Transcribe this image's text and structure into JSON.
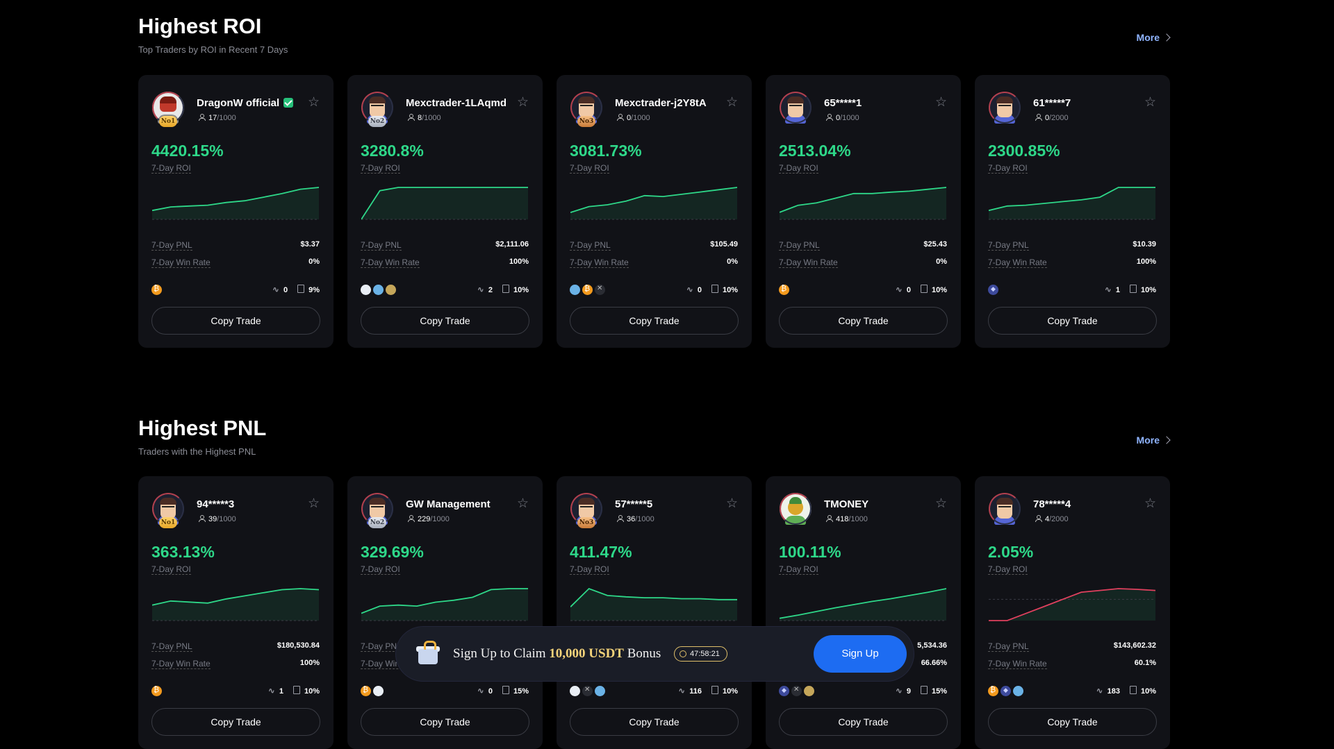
{
  "sections": [
    {
      "title": "Highest ROI",
      "subtitle": "Top Traders by ROI in Recent 7 Days",
      "more": "More",
      "cards": [
        {
          "name": "DragonW official",
          "verified": true,
          "rank": "No1",
          "followers": "17",
          "max": "/1000",
          "roi": "4420.15%",
          "roi_label": "7-Day ROI",
          "pnl_label": "7-Day PNL",
          "pnl": "$3.37",
          "wr_label": "7-Day Win Rate",
          "wr": "0%",
          "coins": [
            "btc"
          ],
          "trades": "0",
          "share": "9%",
          "copy": "Copy Trade",
          "avatar": "robot",
          "spark": [
            0.2,
            0.28,
            0.3,
            0.32,
            0.38,
            0.42,
            0.5,
            0.58,
            0.68,
            0.72
          ]
        },
        {
          "name": "Mexctrader-1LAqmd",
          "verified": false,
          "rank": "No2",
          "followers": "8",
          "max": "/1000",
          "roi": "3280.8%",
          "roi_label": "7-Day ROI",
          "pnl_label": "7-Day PNL",
          "pnl": "$2,111.06",
          "wr_label": "7-Day Win Rate",
          "wr": "100%",
          "coins": [
            "wht",
            "usd",
            "dog"
          ],
          "trades": "2",
          "share": "10%",
          "copy": "Copy Trade",
          "avatar": "person",
          "spark": [
            0.0,
            0.7,
            0.78,
            0.78,
            0.78,
            0.78,
            0.78,
            0.78,
            0.78,
            0.78
          ]
        },
        {
          "name": "Mexctrader-j2Y8tA",
          "verified": false,
          "rank": "No3",
          "followers": "0",
          "max": "/1000",
          "roi": "3081.73%",
          "roi_label": "7-Day ROI",
          "pnl_label": "7-Day PNL",
          "pnl": "$105.49",
          "wr_label": "7-Day Win Rate",
          "wr": "0%",
          "coins": [
            "usd",
            "btc",
            "x"
          ],
          "trades": "0",
          "share": "10%",
          "copy": "Copy Trade",
          "avatar": "person",
          "spark": [
            0.15,
            0.28,
            0.32,
            0.4,
            0.52,
            0.5,
            0.55,
            0.6,
            0.65,
            0.7
          ]
        },
        {
          "name": "65*****1",
          "verified": false,
          "rank": "",
          "followers": "0",
          "max": "/1000",
          "roi": "2513.04%",
          "roi_label": "7-Day ROI",
          "pnl_label": "7-Day PNL",
          "pnl": "$25.43",
          "wr_label": "7-Day Win Rate",
          "wr": "0%",
          "coins": [
            "btc"
          ],
          "trades": "0",
          "share": "10%",
          "copy": "Copy Trade",
          "avatar": "person",
          "spark": [
            0.15,
            0.3,
            0.35,
            0.45,
            0.55,
            0.55,
            0.58,
            0.6,
            0.64,
            0.68
          ]
        },
        {
          "name": "61*****7",
          "verified": false,
          "rank": "",
          "followers": "0",
          "max": "/2000",
          "roi": "2300.85%",
          "roi_label": "7-Day ROI",
          "pnl_label": "7-Day PNL",
          "pnl": "$10.39",
          "wr_label": "7-Day Win Rate",
          "wr": "100%",
          "coins": [
            "eth"
          ],
          "trades": "1",
          "share": "10%",
          "copy": "Copy Trade",
          "avatar": "person",
          "spark": [
            0.2,
            0.3,
            0.32,
            0.36,
            0.4,
            0.44,
            0.5,
            0.72,
            0.72,
            0.72
          ]
        }
      ]
    },
    {
      "title": "Highest PNL",
      "subtitle": "Traders with the Highest PNL",
      "more": "More",
      "cards": [
        {
          "name": "94*****3",
          "verified": false,
          "rank": "No1",
          "followers": "39",
          "max": "/1000",
          "roi": "363.13%",
          "roi_label": "7-Day ROI",
          "pnl_label": "7-Day PNL",
          "pnl": "$180,530.84",
          "wr_label": "7-Day Win Rate",
          "wr": "100%",
          "coins": [
            "btc"
          ],
          "trades": "1",
          "share": "10%",
          "copy": "Copy Trade",
          "avatar": "person",
          "spark": [
            0.3,
            0.38,
            0.36,
            0.34,
            0.42,
            0.48,
            0.54,
            0.6,
            0.62,
            0.6
          ]
        },
        {
          "name": "GW Management",
          "verified": false,
          "rank": "No2",
          "followers": "229",
          "max": "/1000",
          "roi": "329.69%",
          "roi_label": "7-Day ROI",
          "pnl_label": "7-Day PNL",
          "pnl": "",
          "wr_label": "7-Day Win Rate",
          "wr": "",
          "coins": [
            "btc",
            "wht"
          ],
          "trades": "0",
          "share": "15%",
          "copy": "Copy Trade",
          "avatar": "person",
          "spark": [
            0.15,
            0.3,
            0.32,
            0.3,
            0.38,
            0.42,
            0.48,
            0.64,
            0.66,
            0.66
          ]
        },
        {
          "name": "57*****5",
          "verified": false,
          "rank": "No3",
          "followers": "36",
          "max": "/1000",
          "roi": "411.47%",
          "roi_label": "7-Day ROI",
          "pnl_label": "7-Day PNL",
          "pnl": "",
          "wr_label": "7-Day Win Rate",
          "wr": "",
          "coins": [
            "wht",
            "x",
            "usd"
          ],
          "trades": "116",
          "share": "10%",
          "copy": "Copy Trade",
          "avatar": "person",
          "spark": [
            0.3,
            0.7,
            0.55,
            0.52,
            0.5,
            0.5,
            0.48,
            0.48,
            0.46,
            0.46
          ]
        },
        {
          "name": "TMONEY",
          "verified": false,
          "rank": "",
          "followers": "418",
          "max": "/1000",
          "roi": "100.11%",
          "roi_label": "7-Day ROI",
          "pnl_label": "7-Day PNL",
          "pnl": "5,534.36",
          "wr_label": "7-Day Win Rate",
          "wr": "66.66%",
          "coins": [
            "eth",
            "x",
            "dog"
          ],
          "trades": "9",
          "share": "15%",
          "copy": "Copy Trade",
          "avatar": "bird",
          "spark": [
            0.05,
            0.12,
            0.2,
            0.28,
            0.35,
            0.42,
            0.48,
            0.55,
            0.62,
            0.7
          ]
        },
        {
          "name": "78*****4",
          "verified": false,
          "rank": "",
          "followers": "4",
          "max": "/2000",
          "roi": "2.05%",
          "roi_label": "7-Day ROI",
          "pnl_label": "7-Day PNL",
          "pnl": "$143,602.32",
          "wr_label": "7-Day Win Rate",
          "wr": "60.1%",
          "coins": [
            "btc",
            "eth",
            "usd"
          ],
          "trades": "183",
          "share": "10%",
          "copy": "Copy Trade",
          "avatar": "person",
          "spark": [
            -0.6,
            -0.6,
            -0.4,
            -0.2,
            0.0,
            0.2,
            0.25,
            0.3,
            0.28,
            0.25
          ]
        }
      ]
    }
  ],
  "banner": {
    "text_pre": "Sign Up to Claim ",
    "amount": "10,000 USDT",
    "text_post": " Bonus",
    "timer": "47:58:21",
    "button": "Sign Up"
  },
  "colors": {
    "up": "#2ed889",
    "down": "#e0405e",
    "accent": "#1d6cf2"
  }
}
